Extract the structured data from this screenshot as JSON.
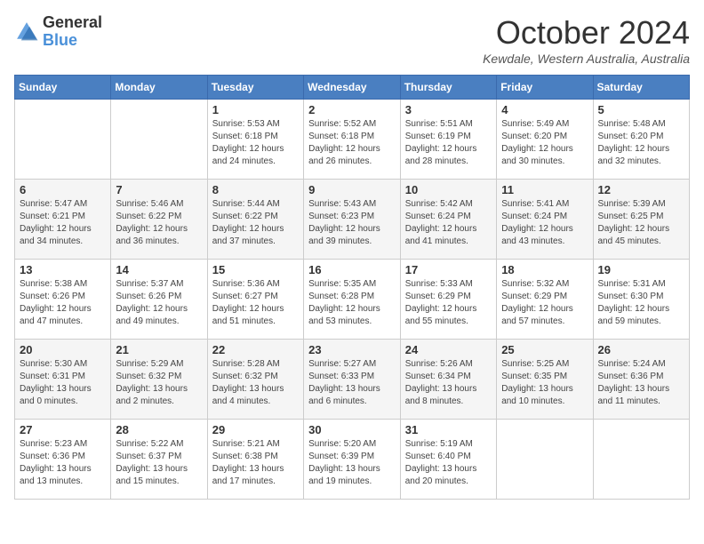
{
  "header": {
    "logo": {
      "general": "General",
      "blue": "Blue"
    },
    "title": "October 2024",
    "location": "Kewdale, Western Australia, Australia"
  },
  "calendar": {
    "days_of_week": [
      "Sunday",
      "Monday",
      "Tuesday",
      "Wednesday",
      "Thursday",
      "Friday",
      "Saturday"
    ],
    "weeks": [
      [
        null,
        null,
        {
          "day": "1",
          "sunrise": "Sunrise: 5:53 AM",
          "sunset": "Sunset: 6:18 PM",
          "daylight": "Daylight: 12 hours and 24 minutes."
        },
        {
          "day": "2",
          "sunrise": "Sunrise: 5:52 AM",
          "sunset": "Sunset: 6:18 PM",
          "daylight": "Daylight: 12 hours and 26 minutes."
        },
        {
          "day": "3",
          "sunrise": "Sunrise: 5:51 AM",
          "sunset": "Sunset: 6:19 PM",
          "daylight": "Daylight: 12 hours and 28 minutes."
        },
        {
          "day": "4",
          "sunrise": "Sunrise: 5:49 AM",
          "sunset": "Sunset: 6:20 PM",
          "daylight": "Daylight: 12 hours and 30 minutes."
        },
        {
          "day": "5",
          "sunrise": "Sunrise: 5:48 AM",
          "sunset": "Sunset: 6:20 PM",
          "daylight": "Daylight: 12 hours and 32 minutes."
        }
      ],
      [
        {
          "day": "6",
          "sunrise": "Sunrise: 5:47 AM",
          "sunset": "Sunset: 6:21 PM",
          "daylight": "Daylight: 12 hours and 34 minutes."
        },
        {
          "day": "7",
          "sunrise": "Sunrise: 5:46 AM",
          "sunset": "Sunset: 6:22 PM",
          "daylight": "Daylight: 12 hours and 36 minutes."
        },
        {
          "day": "8",
          "sunrise": "Sunrise: 5:44 AM",
          "sunset": "Sunset: 6:22 PM",
          "daylight": "Daylight: 12 hours and 37 minutes."
        },
        {
          "day": "9",
          "sunrise": "Sunrise: 5:43 AM",
          "sunset": "Sunset: 6:23 PM",
          "daylight": "Daylight: 12 hours and 39 minutes."
        },
        {
          "day": "10",
          "sunrise": "Sunrise: 5:42 AM",
          "sunset": "Sunset: 6:24 PM",
          "daylight": "Daylight: 12 hours and 41 minutes."
        },
        {
          "day": "11",
          "sunrise": "Sunrise: 5:41 AM",
          "sunset": "Sunset: 6:24 PM",
          "daylight": "Daylight: 12 hours and 43 minutes."
        },
        {
          "day": "12",
          "sunrise": "Sunrise: 5:39 AM",
          "sunset": "Sunset: 6:25 PM",
          "daylight": "Daylight: 12 hours and 45 minutes."
        }
      ],
      [
        {
          "day": "13",
          "sunrise": "Sunrise: 5:38 AM",
          "sunset": "Sunset: 6:26 PM",
          "daylight": "Daylight: 12 hours and 47 minutes."
        },
        {
          "day": "14",
          "sunrise": "Sunrise: 5:37 AM",
          "sunset": "Sunset: 6:26 PM",
          "daylight": "Daylight: 12 hours and 49 minutes."
        },
        {
          "day": "15",
          "sunrise": "Sunrise: 5:36 AM",
          "sunset": "Sunset: 6:27 PM",
          "daylight": "Daylight: 12 hours and 51 minutes."
        },
        {
          "day": "16",
          "sunrise": "Sunrise: 5:35 AM",
          "sunset": "Sunset: 6:28 PM",
          "daylight": "Daylight: 12 hours and 53 minutes."
        },
        {
          "day": "17",
          "sunrise": "Sunrise: 5:33 AM",
          "sunset": "Sunset: 6:29 PM",
          "daylight": "Daylight: 12 hours and 55 minutes."
        },
        {
          "day": "18",
          "sunrise": "Sunrise: 5:32 AM",
          "sunset": "Sunset: 6:29 PM",
          "daylight": "Daylight: 12 hours and 57 minutes."
        },
        {
          "day": "19",
          "sunrise": "Sunrise: 5:31 AM",
          "sunset": "Sunset: 6:30 PM",
          "daylight": "Daylight: 12 hours and 59 minutes."
        }
      ],
      [
        {
          "day": "20",
          "sunrise": "Sunrise: 5:30 AM",
          "sunset": "Sunset: 6:31 PM",
          "daylight": "Daylight: 13 hours and 0 minutes."
        },
        {
          "day": "21",
          "sunrise": "Sunrise: 5:29 AM",
          "sunset": "Sunset: 6:32 PM",
          "daylight": "Daylight: 13 hours and 2 minutes."
        },
        {
          "day": "22",
          "sunrise": "Sunrise: 5:28 AM",
          "sunset": "Sunset: 6:32 PM",
          "daylight": "Daylight: 13 hours and 4 minutes."
        },
        {
          "day": "23",
          "sunrise": "Sunrise: 5:27 AM",
          "sunset": "Sunset: 6:33 PM",
          "daylight": "Daylight: 13 hours and 6 minutes."
        },
        {
          "day": "24",
          "sunrise": "Sunrise: 5:26 AM",
          "sunset": "Sunset: 6:34 PM",
          "daylight": "Daylight: 13 hours and 8 minutes."
        },
        {
          "day": "25",
          "sunrise": "Sunrise: 5:25 AM",
          "sunset": "Sunset: 6:35 PM",
          "daylight": "Daylight: 13 hours and 10 minutes."
        },
        {
          "day": "26",
          "sunrise": "Sunrise: 5:24 AM",
          "sunset": "Sunset: 6:36 PM",
          "daylight": "Daylight: 13 hours and 11 minutes."
        }
      ],
      [
        {
          "day": "27",
          "sunrise": "Sunrise: 5:23 AM",
          "sunset": "Sunset: 6:36 PM",
          "daylight": "Daylight: 13 hours and 13 minutes."
        },
        {
          "day": "28",
          "sunrise": "Sunrise: 5:22 AM",
          "sunset": "Sunset: 6:37 PM",
          "daylight": "Daylight: 13 hours and 15 minutes."
        },
        {
          "day": "29",
          "sunrise": "Sunrise: 5:21 AM",
          "sunset": "Sunset: 6:38 PM",
          "daylight": "Daylight: 13 hours and 17 minutes."
        },
        {
          "day": "30",
          "sunrise": "Sunrise: 5:20 AM",
          "sunset": "Sunset: 6:39 PM",
          "daylight": "Daylight: 13 hours and 19 minutes."
        },
        {
          "day": "31",
          "sunrise": "Sunrise: 5:19 AM",
          "sunset": "Sunset: 6:40 PM",
          "daylight": "Daylight: 13 hours and 20 minutes."
        },
        null,
        null
      ]
    ]
  }
}
